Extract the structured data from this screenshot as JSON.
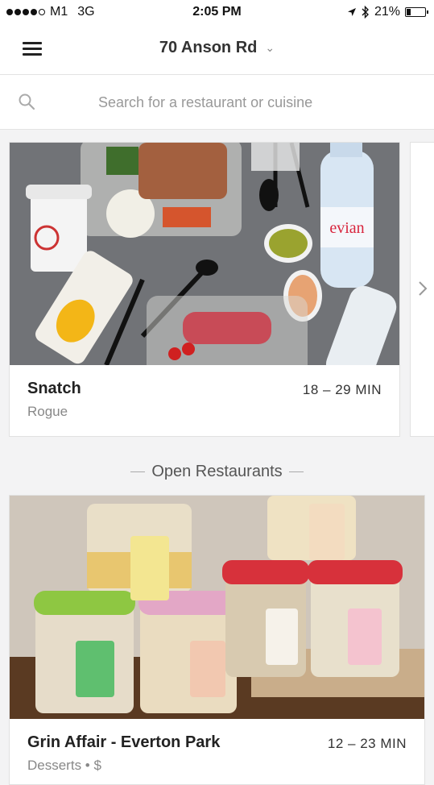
{
  "status_bar": {
    "carrier": "M1",
    "network": "3G",
    "time": "2:05 PM",
    "battery": "21%",
    "signal_bars_filled": 4,
    "signal_bars_total": 5
  },
  "header": {
    "location": "70 Anson Rd"
  },
  "search": {
    "placeholder": "Search for a restaurant or cuisine"
  },
  "featured": [
    {
      "name": "Snatch",
      "subtitle": "Rogue",
      "delivery_time": "18 – 29 MIN"
    }
  ],
  "section": {
    "title": "Open Restaurants"
  },
  "restaurants": [
    {
      "name": "Grin Affair - Everton Park",
      "subtitle": "Desserts • $",
      "delivery_time": "12 – 23 MIN"
    }
  ],
  "colors": {
    "background": "#f3f3f4",
    "text": "#222222",
    "muted": "#888888"
  }
}
